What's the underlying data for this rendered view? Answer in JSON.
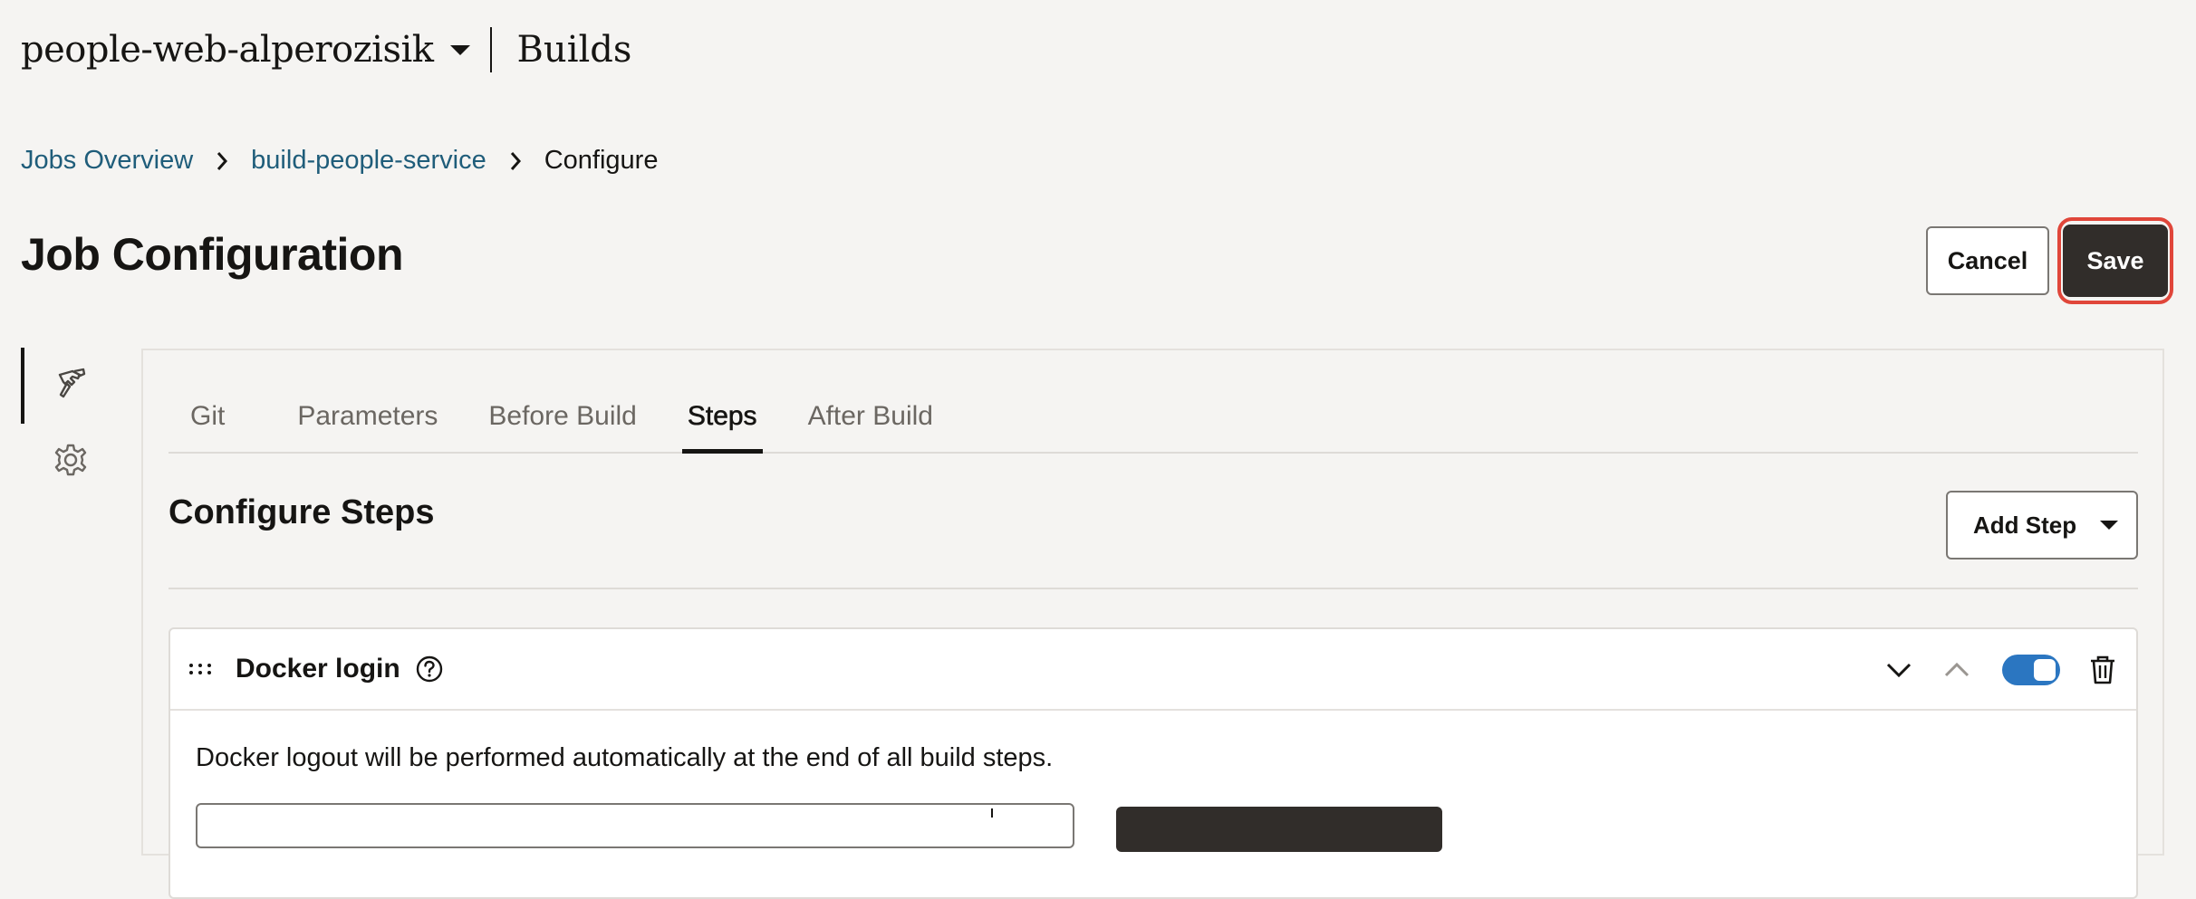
{
  "header": {
    "project": "people-web-alperozisik",
    "section": "Builds"
  },
  "breadcrumb": {
    "items": [
      "Jobs Overview",
      "build-people-service",
      "Configure"
    ]
  },
  "page": {
    "title": "Job Configuration",
    "cancel_label": "Cancel",
    "save_label": "Save"
  },
  "side_nav": {
    "items": [
      {
        "icon": "hammer-icon",
        "active": true
      },
      {
        "icon": "gear-icon",
        "active": false
      }
    ]
  },
  "tabs": {
    "items": [
      "Git",
      "Parameters",
      "Before Build",
      "Steps",
      "After Build"
    ],
    "active": "Steps"
  },
  "steps_section": {
    "title": "Configure Steps",
    "add_step_label": "Add Step"
  },
  "step": {
    "name": "Docker login",
    "enabled": true,
    "description": "Docker logout will be performed automatically at the end of all build steps."
  },
  "colors": {
    "accent_blue": "#2b76c1",
    "link": "#1f5d7a",
    "primary_button": "#312d2a",
    "highlight": "#e0463a"
  }
}
